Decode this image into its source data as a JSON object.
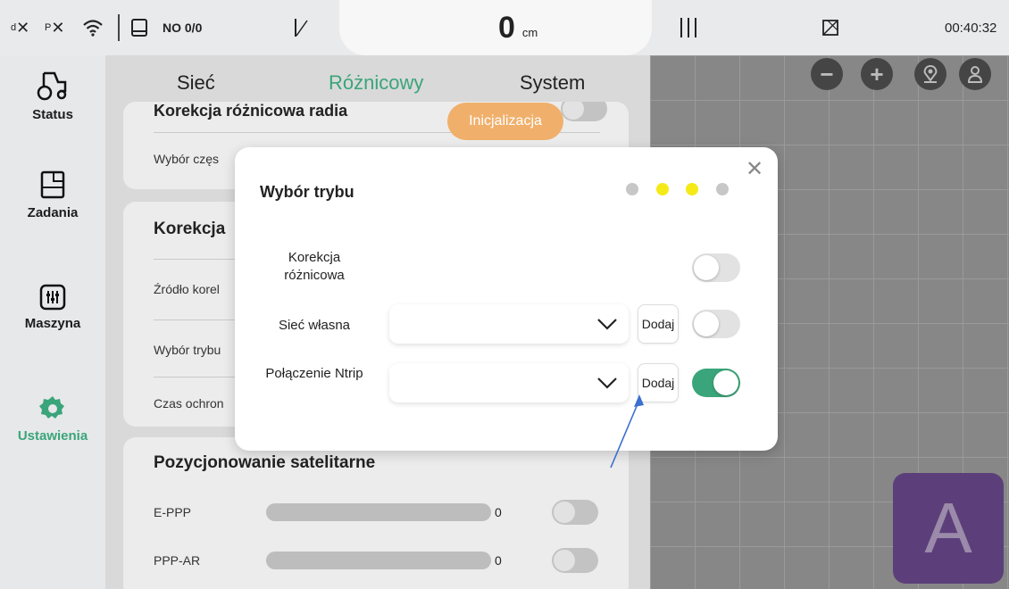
{
  "status_bar": {
    "signal_d": "d",
    "signal_p": "P",
    "rtk_status": "NO 0/0",
    "offset_value": "0",
    "offset_unit": "cm",
    "time": "00:40:32"
  },
  "sidebar": {
    "items": [
      {
        "label": "Status",
        "icon": "tractor-icon"
      },
      {
        "label": "Zadania",
        "icon": "clipboard-icon"
      },
      {
        "label": "Maszyna",
        "icon": "sliders-icon"
      },
      {
        "label": "Ustawienia",
        "icon": "gear-icon",
        "active": true
      }
    ]
  },
  "settings": {
    "tabs": [
      "Sieć",
      "Różnicowy",
      "System"
    ],
    "active_tab": "Różnicowy",
    "card1": {
      "row1": "Korekcja różnicowa radia",
      "row2": "Wybór częs"
    },
    "card2": {
      "header": "Korekcja",
      "rows": [
        "Źródło korel",
        "Wybór trybu",
        "Czas ochron"
      ]
    },
    "card3": {
      "header": "Pozycjonowanie satelitarne",
      "rows": [
        {
          "label": "E-PPP",
          "value": "0"
        },
        {
          "label": "PPP-AR",
          "value": "0"
        }
      ]
    }
  },
  "init_pill": "Inicjalizacja",
  "modal": {
    "title": "Wybór trybu",
    "step_dots": [
      "#c7c7c7",
      "#f5ea17",
      "#f5ea17",
      "#c7c7c7"
    ],
    "rows": [
      {
        "label": "Korekcja różnicowa",
        "toggle_on": false
      },
      {
        "label": "Sieć własna",
        "button": "Dodaj",
        "toggle_on": false
      },
      {
        "label": "Połączenie Ntrip",
        "button": "Dodaj",
        "toggle_on": true
      }
    ]
  },
  "map_controls": [
    "zoom-out-icon",
    "zoom-in-icon",
    "locate-icon",
    "user-location-icon"
  ],
  "a_button": "A",
  "colors": {
    "accent_green": "#3aa57a",
    "init_orange": "#f0b06c",
    "a_button_bg": "#5c3f7a"
  }
}
